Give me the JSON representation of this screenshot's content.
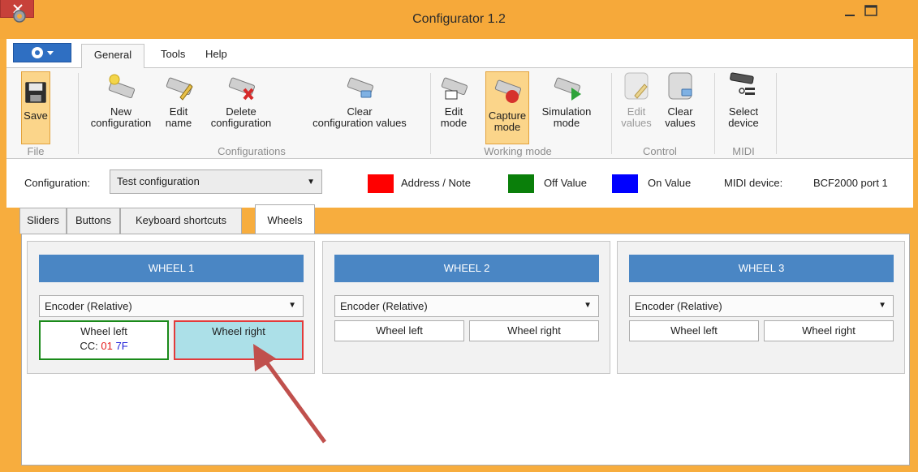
{
  "window": {
    "title": "Configurator 1.2"
  },
  "ribbon_tabs": [
    "General",
    "Tools",
    "Help"
  ],
  "ribbon": {
    "file": {
      "save": "Save",
      "group": "File"
    },
    "configurations": {
      "new": [
        "New",
        "configuration"
      ],
      "edit": [
        "Edit",
        "name"
      ],
      "delete": [
        "Delete",
        "configuration"
      ],
      "clear": [
        "Clear",
        "configuration values"
      ],
      "group": "Configurations"
    },
    "working_mode": {
      "edit": [
        "Edit",
        "mode"
      ],
      "capture": [
        "Capture",
        "mode"
      ],
      "simulation": [
        "Simulation",
        "mode"
      ],
      "group": "Working mode"
    },
    "control": {
      "edit_values": [
        "Edit",
        "values"
      ],
      "clear_values": [
        "Clear",
        "values"
      ],
      "group": "Control"
    },
    "midi": {
      "select": [
        "Select",
        "device"
      ],
      "group": "MIDI"
    }
  },
  "config_bar": {
    "label": "Configuration:",
    "selected": "Test configuration",
    "legend": [
      {
        "label": "Address / Note",
        "color": "#ff0000"
      },
      {
        "label": "Off Value",
        "color": "#0a7f0a"
      },
      {
        "label": "On Value",
        "color": "#0000ff"
      }
    ],
    "midi_label": "MIDI device:",
    "midi_value": "BCF2000 port 1"
  },
  "tabs": [
    "Sliders",
    "Buttons",
    "Keyboard shortcuts",
    "Wheels"
  ],
  "selected_tab": "Wheels",
  "wheels": [
    {
      "title": "WHEEL 1",
      "mode": "Encoder (Relative)",
      "left": "Wheel left",
      "right": "Wheel right",
      "cc_label": "CC:",
      "cc_address": "01",
      "cc_value": "7F"
    },
    {
      "title": "WHEEL 2",
      "mode": "Encoder (Relative)",
      "left": "Wheel left",
      "right": "Wheel right"
    },
    {
      "title": "WHEEL 3",
      "mode": "Encoder (Relative)",
      "left": "Wheel left",
      "right": "Wheel right"
    }
  ],
  "colors": {
    "accent": "#f6a93a",
    "header": "#4a86c4",
    "highlight": "#ace0e8"
  }
}
